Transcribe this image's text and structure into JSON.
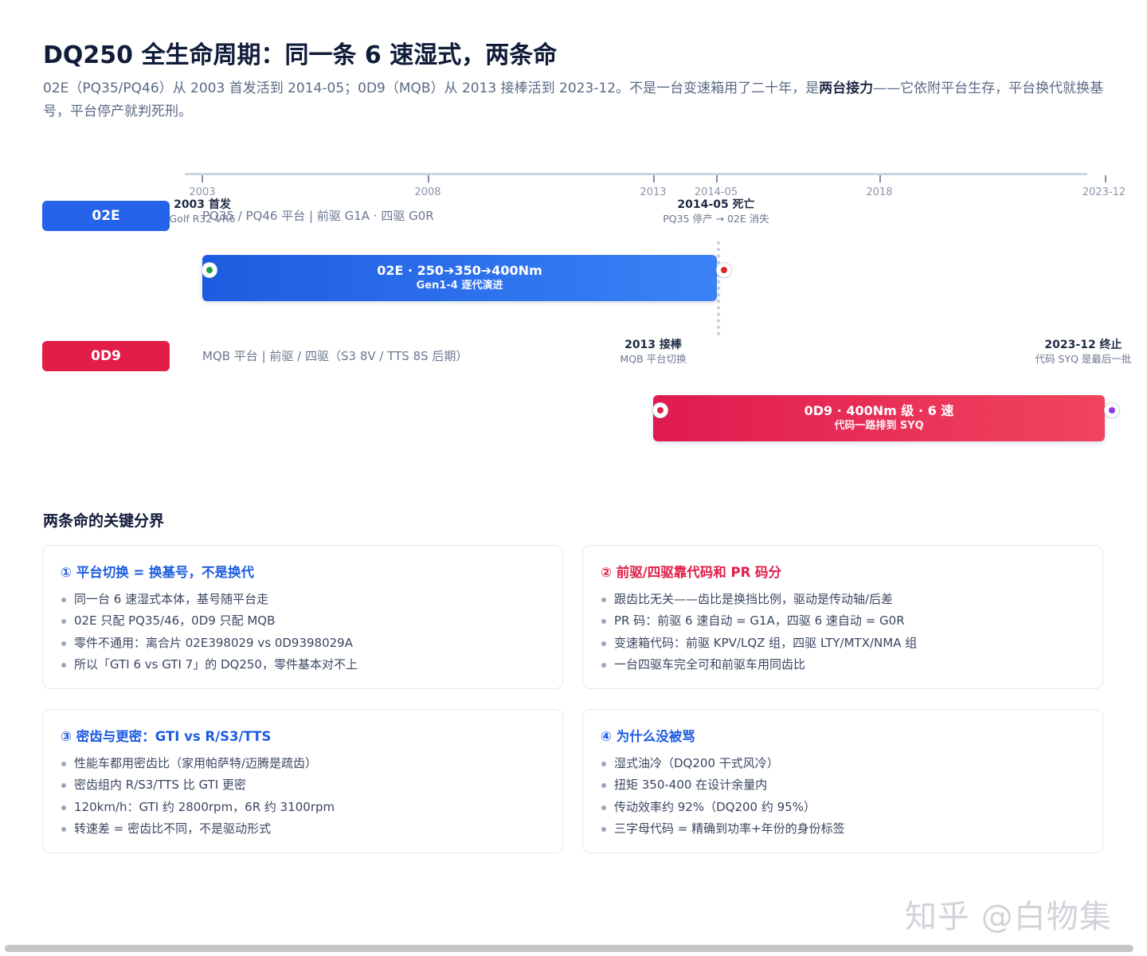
{
  "header": {
    "title": "DQ250 全生命周期：同一条 6 速湿式，两条命",
    "subtitle_pre": "02E（PQ35/PQ46）从 2003 首发活到 2014-05；0D9（MQB）从 2013 接棒活到 2023-12。不是一台变速箱用了二十年，是",
    "subtitle_bold": "两台接力",
    "subtitle_post": "——它依附平台生存，平台换代就换基号，平台停产就判死刑。"
  },
  "timeline": {
    "ticks": [
      "2003",
      "2008",
      "2013",
      "2014-05",
      "2018",
      "2023-12"
    ],
    "tracks": [
      {
        "chip": "02E",
        "desc": "PQ35 / PQ46 平台 | 前驱 G1A · 四驱 G0R",
        "bar_title": "02E · 250➔350➔400Nm",
        "bar_sub": "Gen1-4 逐代演进",
        "start": {
          "title": "2003 首发",
          "sub": "Golf R32 VR6"
        },
        "end": {
          "title": "2014-05 死亡",
          "sub": "PQ35 停产 → 02E 消失"
        },
        "color": "#2563eb"
      },
      {
        "chip": "0D9",
        "desc": "MQB 平台 | 前驱 / 四驱（S3 8V / TTS 8S 后期）",
        "bar_title": "0D9 · 400Nm 级 · 6 速",
        "bar_sub": "代码一路排到 SYQ",
        "start": {
          "title": "2013 接棒",
          "sub": "MQB 平台切换"
        },
        "end": {
          "title": "2023-12 终止",
          "sub": "代码 SYQ 是最后一批"
        },
        "color": "#e11d48"
      }
    ],
    "dot_colors": {
      "start_02e": "#16a34a",
      "end_02e": "#dc2626",
      "start_0d9": "#e11d48",
      "end_0d9": "#9333ea"
    }
  },
  "section": {
    "title": "两条命的关键分界"
  },
  "cards": [
    {
      "title": "① 平台切换 = 换基号，不是换代",
      "color": "#1d5ce0",
      "items": [
        "同一台 6 速湿式本体，基号随平台走",
        "02E 只配 PQ35/46，0D9 只配 MQB",
        "零件不通用：离合片 02E398029 vs 0D9398029A",
        "所以「GTI 6 vs GTI 7」的 DQ250，零件基本对不上"
      ]
    },
    {
      "title": "② 前驱/四驱靠代码和 PR 码分",
      "color": "#e11d48",
      "items": [
        "跟齿比无关——齿比是换挡比例，驱动是传动轴/后差",
        "PR 码：前驱 6 速自动 = G1A，四驱 6 速自动 = G0R",
        "变速箱代码：前驱 KPV/LQZ 组，四驱 LTY/MTX/NMA 组",
        "一台四驱车完全可和前驱车用同齿比"
      ]
    },
    {
      "title": "③ 密齿与更密：GTI vs R/S3/TTS",
      "color": "#1d5ce0",
      "items": [
        "性能车都用密齿比（家用帕萨特/迈腾是疏齿）",
        "密齿组内 R/S3/TTS 比 GTI 更密",
        "120km/h：GTI 约 2800rpm，6R 约 3100rpm",
        "转速差 = 密齿比不同，不是驱动形式"
      ]
    },
    {
      "title": "④ 为什么没被骂",
      "color": "#1d5ce0",
      "items": [
        "湿式油冷（DQ200 干式风冷）",
        "扭矩 350-400 在设计余量内",
        "传动效率约 92%（DQ200 约 95%）",
        "三字母代码 = 精确到功率+年份的身份标签"
      ]
    }
  ],
  "watermark": "知乎 @白物集"
}
